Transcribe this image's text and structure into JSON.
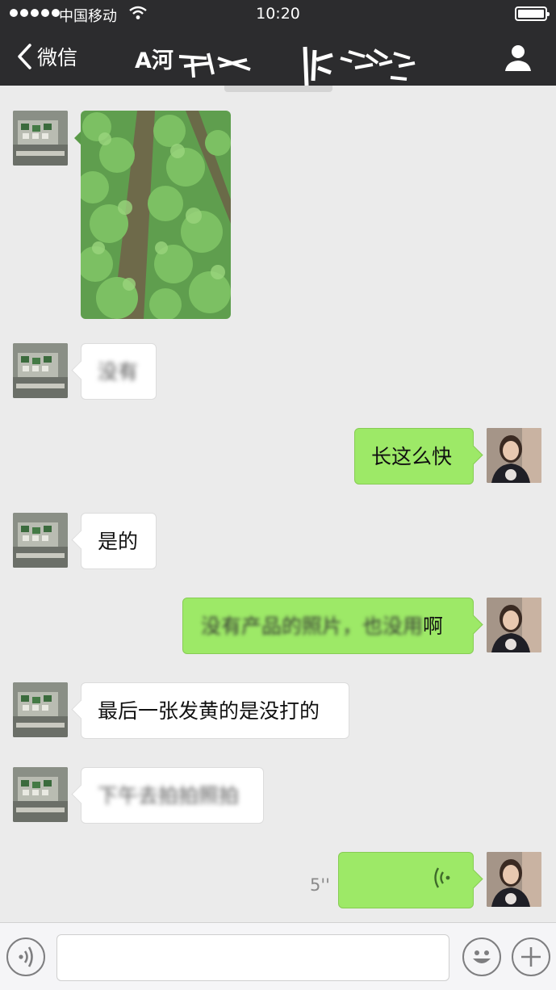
{
  "status_bar": {
    "carrier": "中国移动",
    "time": "10:20"
  },
  "nav": {
    "back_label": "微信",
    "chat_title": "A河",
    "profile_icon": "person-icon"
  },
  "messages": [
    {
      "sender": "contact",
      "type": "image",
      "description_icon": "photo-icon"
    },
    {
      "sender": "contact",
      "type": "text",
      "text": "没有",
      "blurred": true
    },
    {
      "sender": "me",
      "type": "text",
      "text": "长这么快"
    },
    {
      "sender": "contact",
      "type": "text",
      "text": "是的"
    },
    {
      "sender": "me",
      "type": "text",
      "text_blurred": "没有产品的照片，也没用",
      "text_clear": "啊"
    },
    {
      "sender": "contact",
      "type": "text",
      "text": "最后一张发黄的是没打的"
    },
    {
      "sender": "contact",
      "type": "text",
      "text": "下午去拍拍照拍",
      "blurred": true
    },
    {
      "sender": "me",
      "type": "voice",
      "duration": "5''"
    }
  ],
  "input_bar": {
    "voice_toggle_icon": "voice-icon",
    "text_value": "",
    "emoji_icon": "emoji-icon",
    "plus_icon": "plus-icon"
  },
  "colors": {
    "nav_background": "#2c2c2e",
    "chat_background": "#ebebeb",
    "outgoing_bubble": "#9de967",
    "incoming_bubble": "#ffffff"
  }
}
